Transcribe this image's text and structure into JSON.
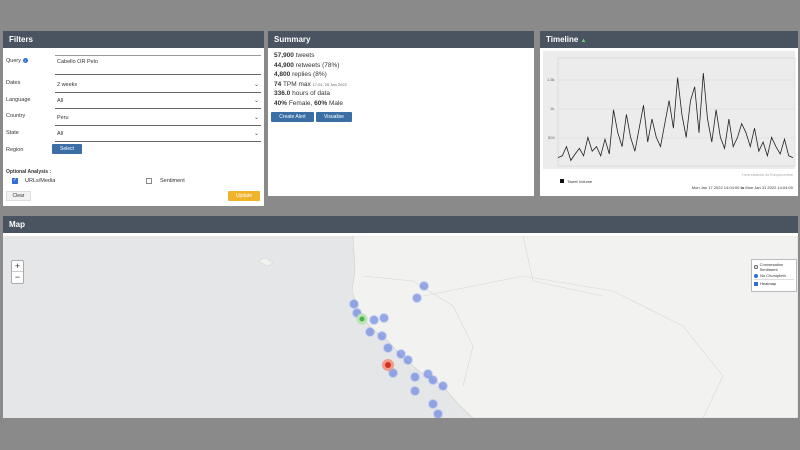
{
  "filters": {
    "title": "Filters",
    "query_label": "Query",
    "query_value": "Cabello OR Pelo",
    "dates_label": "Dates",
    "dates_value": "2 weeks",
    "language_label": "Language",
    "language_value": "All",
    "country_label": "Country",
    "country_value": "Peru",
    "state_label": "State",
    "state_value": "All",
    "region_label": "Region",
    "select_btn": "Select",
    "optional_label": "Optional Analysis :",
    "urls_label": "URLs/Media",
    "sentiment_label": "Sentiment",
    "clear_btn": "Clear",
    "update_btn": "Update"
  },
  "summary": {
    "title": "Summary",
    "tweets_num": "57,900",
    "tweets_txt": "tweets",
    "retweets_num": "44,900",
    "retweets_txt": "retweets (78%)",
    "replies_num": "4,800",
    "replies_txt": "replies (8%)",
    "tpm_num": "74",
    "tpm_txt": "TPM max",
    "tpm_time": "17:01, 25 Jan 2022",
    "hours_num": "336.0",
    "hours_txt": "hours of data",
    "gender_female_pct": "40%",
    "gender_female_txt": "Female,",
    "gender_male_pct": "60%",
    "gender_male_txt": "Male",
    "create_alert_btn": "Create Alert",
    "visualise_btn": "Visualise"
  },
  "timeline": {
    "title": "Timeline",
    "watermark": "Hora estándar de Europa central",
    "legend": "Tweet Volume",
    "range_start": "Mon Jan 17 2022 14:04:00",
    "range_to": "to",
    "range_end": "Mon Jan 31 2022 14:04:00",
    "yticks": [
      "1.5k",
      "1k",
      "500"
    ],
    "line_color": "#222222"
  },
  "map": {
    "title": "Map",
    "zoom_in": "+",
    "zoom_out": "−",
    "layer_conversation": "Conversation Sentiment",
    "layer_choropleth": "No Choropleth",
    "layer_heatmap": "Heatmap",
    "heat_color": "#4a6cd8",
    "marker_green": "#4caf50",
    "marker_red": "#d7301f"
  }
}
